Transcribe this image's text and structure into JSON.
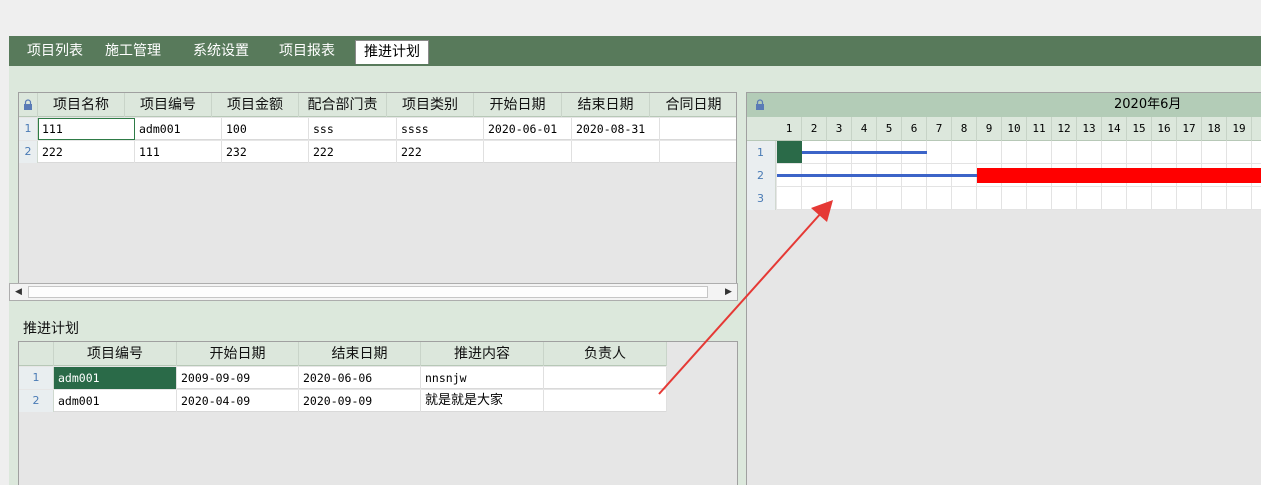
{
  "tabs": [
    {
      "label": "项目列表"
    },
    {
      "label": "施工管理"
    },
    {
      "label": "系统设置"
    },
    {
      "label": "项目报表"
    },
    {
      "label": "推进计划",
      "active": true
    }
  ],
  "project_grid": {
    "columns": [
      "项目名称",
      "项目编号",
      "项目金额",
      "配合部门责",
      "项目类别",
      "开始日期",
      "结束日期",
      "合同日期"
    ],
    "rows": [
      {
        "num": "1",
        "cells": [
          "111",
          "adm001",
          "100",
          "sss",
          "ssss",
          "2020-06-01",
          "2020-08-31",
          ""
        ]
      },
      {
        "num": "2",
        "cells": [
          "222",
          "111",
          "232",
          "222",
          "222",
          "",
          "",
          ""
        ]
      }
    ]
  },
  "plan_section": {
    "title": "推进计划",
    "columns": [
      "项目编号",
      "开始日期",
      "结束日期",
      "推进内容",
      "负责人"
    ],
    "rows": [
      {
        "num": "1",
        "cells": [
          "adm001",
          "2009-09-09",
          "2020-06-06",
          "nnsnjw",
          ""
        ]
      },
      {
        "num": "2",
        "cells": [
          "adm001",
          "2020-04-09",
          "2020-09-09",
          "就是就是大家",
          ""
        ]
      }
    ]
  },
  "gantt": {
    "month_label": "2020年6月",
    "days": [
      "1",
      "2",
      "3",
      "4",
      "5",
      "6",
      "7",
      "8",
      "9",
      "10",
      "11",
      "12",
      "13",
      "14",
      "15",
      "16",
      "17",
      "18",
      "19",
      "2"
    ],
    "rows": [
      "1",
      "2",
      "3"
    ],
    "bars": [
      {
        "row": 1,
        "type": "progress",
        "from_day": 1,
        "to_day": 6,
        "color": "#3c64c8"
      },
      {
        "row": 1,
        "type": "marker",
        "from_day": 1,
        "to_day": 1,
        "color": "#2a6a48"
      },
      {
        "row": 2,
        "type": "progress",
        "from_day": 1,
        "to_day": 9,
        "color": "#3c64c8"
      },
      {
        "row": 2,
        "type": "block",
        "from_day": 9,
        "to_day": 20,
        "color": "#ff0000"
      }
    ]
  },
  "colors": {
    "tab_bar": "#587a5b",
    "panel_bg": "#dce8dc",
    "selection": "#2a6a48",
    "annotation_arrow": "#e53935"
  }
}
